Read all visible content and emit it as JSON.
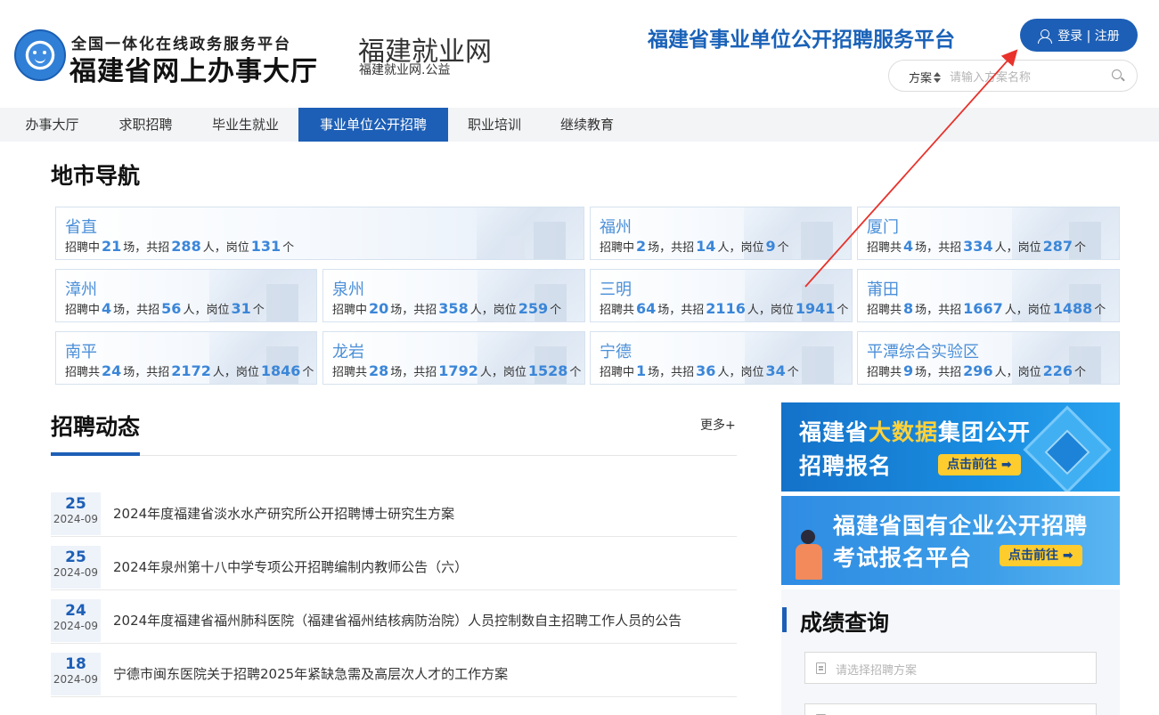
{
  "header": {
    "logo_line1": "全国一体化在线政务服务平台",
    "logo_line2": "福建省网上办事大厅",
    "site_name": "福建就业网",
    "site_domain": "福建就业网.公益",
    "platform_title": "福建省事业单位公开招聘服务平台",
    "login_label": "登录 | 注册",
    "search": {
      "type_label": "方案",
      "placeholder": "请输入方案名称"
    }
  },
  "nav": {
    "items": [
      {
        "label": "办事大厅"
      },
      {
        "label": "求职招聘"
      },
      {
        "label": "毕业生就业"
      },
      {
        "label": "事业单位公开招聘",
        "active": true
      },
      {
        "label": "职业培训"
      },
      {
        "label": "继续教育"
      }
    ]
  },
  "city_nav": {
    "title": "地市导航",
    "cities": [
      {
        "name": "省直",
        "status": "招聘中",
        "sessions": "21",
        "people": "288",
        "posts": "131"
      },
      {
        "name": "福州",
        "status": "招聘中",
        "sessions": "2",
        "people": "14",
        "posts": "9"
      },
      {
        "name": "厦门",
        "status": "招聘共",
        "sessions": "4",
        "people": "334",
        "posts": "287"
      },
      {
        "name": "漳州",
        "status": "招聘中",
        "sessions": "4",
        "people": "56",
        "posts": "31"
      },
      {
        "name": "泉州",
        "status": "招聘中",
        "sessions": "20",
        "people": "358",
        "posts": "259"
      },
      {
        "name": "三明",
        "status": "招聘共",
        "sessions": "64",
        "people": "2116",
        "posts": "1941"
      },
      {
        "name": "莆田",
        "status": "招聘共",
        "sessions": "8",
        "people": "1667",
        "posts": "1488"
      },
      {
        "name": "南平",
        "status": "招聘共",
        "sessions": "24",
        "people": "2172",
        "posts": "1846"
      },
      {
        "name": "龙岩",
        "status": "招聘共",
        "sessions": "28",
        "people": "1792",
        "posts": "1528"
      },
      {
        "name": "宁德",
        "status": "招聘中",
        "sessions": "1",
        "people": "36",
        "posts": "34"
      },
      {
        "name": "平潭综合实验区",
        "status": "招聘共",
        "sessions": "9",
        "people": "296",
        "posts": "226"
      }
    ],
    "unit_sessions": "场，共招",
    "unit_people": "人，岗位",
    "unit_posts": "个"
  },
  "news": {
    "title": "招聘动态",
    "more_label": "更多+",
    "items": [
      {
        "day": "25",
        "ym": "2024-09",
        "title": "2024年度福建省淡水水产研究所公开招聘博士研究生方案"
      },
      {
        "day": "25",
        "ym": "2024-09",
        "title": "2024年泉州第十八中学专项公开招聘编制内教师公告（六）"
      },
      {
        "day": "24",
        "ym": "2024-09",
        "title": "2024年度福建省福州肺科医院（福建省福州结核病防治院）人员控制数自主招聘工作人员的公告"
      },
      {
        "day": "18",
        "ym": "2024-09",
        "title": "宁德市闽东医院关于招聘2025年紧缺急需及高层次人才的工作方案"
      }
    ]
  },
  "banners": {
    "b1": {
      "prefix": "福建省",
      "highlight": "大数据",
      "suffix": "集团公开",
      "line2": "招聘报名",
      "button": "点击前往 ➡"
    },
    "b2": {
      "line1": "福建省国有企业公开招聘",
      "line2": "考试报名平台",
      "button": "点击前往 ➡"
    }
  },
  "score": {
    "title": "成绩查询",
    "select_placeholder": "请选择招聘方案"
  },
  "colors": {
    "brand_blue": "#1d5fb6",
    "number_blue": "#3b86d8",
    "banner_yellow": "#ffcc2e",
    "annotation_red": "#e8322b"
  }
}
